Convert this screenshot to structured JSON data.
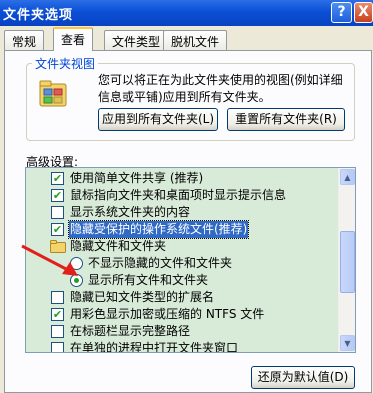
{
  "window": {
    "title": "文件夹选项",
    "help_label": "?",
    "close_label": "X"
  },
  "tabs": [
    {
      "label": "常规"
    },
    {
      "label": "查看"
    },
    {
      "label": "文件类型"
    },
    {
      "label": "脱机文件"
    }
  ],
  "folder_views": {
    "group_label": "文件夹视图",
    "description": "您可以将正在为此文件夹使用的视图(例如详细信息或平铺)应用到所有文件夹。",
    "apply_all_label": "应用到所有文件夹(L)",
    "reset_all_label": "重置所有文件夹(R)"
  },
  "advanced": {
    "label": "高级设置:",
    "items": [
      {
        "type": "checkbox",
        "checked": true,
        "label": "使用简单文件共享 (推荐)"
      },
      {
        "type": "checkbox",
        "checked": true,
        "label": "鼠标指向文件夹和桌面项时显示提示信息"
      },
      {
        "type": "checkbox",
        "checked": false,
        "label": "显示系统文件夹的内容"
      },
      {
        "type": "checkbox",
        "checked": true,
        "label": "隐藏受保护的操作系统文件(推荐)",
        "selected": true
      },
      {
        "type": "folder",
        "label": "隐藏文件和文件夹"
      },
      {
        "type": "radio",
        "checked": false,
        "label": "不显示隐藏的文件和文件夹"
      },
      {
        "type": "radio",
        "checked": true,
        "label": "显示所有文件和文件夹"
      },
      {
        "type": "checkbox",
        "checked": false,
        "label": "隐藏已知文件类型的扩展名"
      },
      {
        "type": "checkbox",
        "checked": true,
        "label": "用彩色显示加密或压缩的 NTFS 文件"
      },
      {
        "type": "checkbox",
        "checked": false,
        "label": "在标题栏显示完整路径"
      },
      {
        "type": "checkbox",
        "checked": false,
        "label": "在单独的进程中打开文件夹窗口"
      }
    ]
  },
  "restore_defaults_label": "还原为默认值(D)",
  "colors": {
    "selection": "#316ac5",
    "list_background": "#d8ead8",
    "check": "#21a121",
    "annotation_arrow": "#e0201a"
  }
}
